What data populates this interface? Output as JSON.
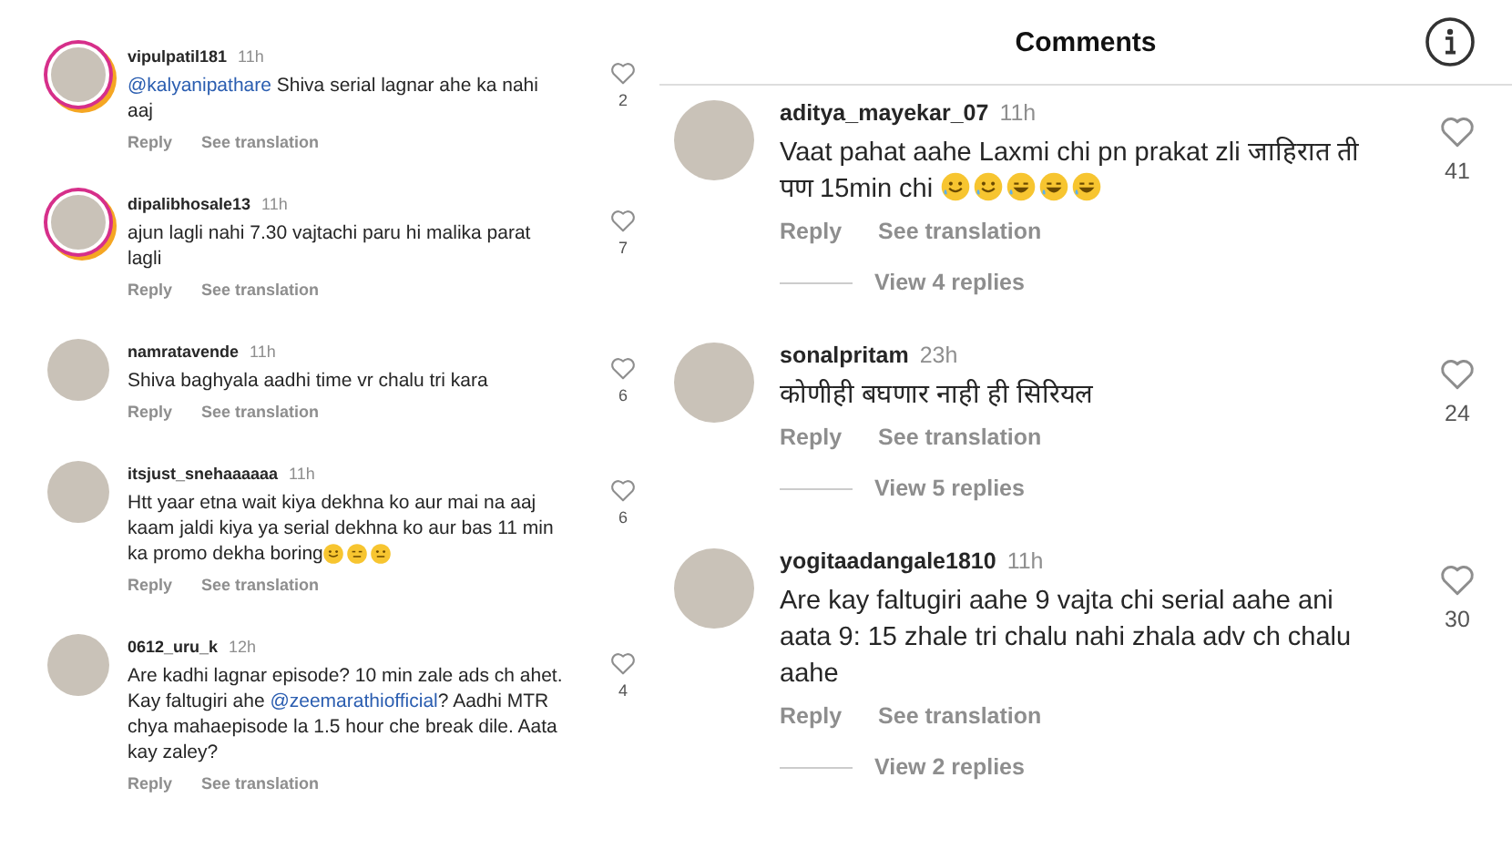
{
  "left_panel": {
    "comments": [
      {
        "username": "vipulpatil181",
        "time": "11h",
        "story": true,
        "parts": [
          {
            "kind": "mention",
            "text": "@kalyanipathare"
          },
          {
            "kind": "plain",
            "text": "  Shiva serial lagnar ahe ka nahi aaj"
          }
        ],
        "actions": [
          "Reply",
          "See translation"
        ],
        "likes": "2"
      },
      {
        "username": "dipalibhosale13",
        "time": "11h",
        "story": true,
        "parts": [
          {
            "kind": "plain",
            "text": "ajun lagli nahi 7.30 vajtachi paru hi malika parat lagli"
          }
        ],
        "actions": [
          "Reply",
          "See translation"
        ],
        "likes": "7"
      },
      {
        "username": "namratavende",
        "time": "11h",
        "story": false,
        "parts": [
          {
            "kind": "plain",
            "text": "Shiva baghyala aadhi time vr chalu tri kara"
          }
        ],
        "actions": [
          "Reply",
          "See translation"
        ],
        "likes": "6"
      },
      {
        "username": "itsjust_snehaaaaaa",
        "time": "11h",
        "story": false,
        "parts": [
          {
            "kind": "plain",
            "text": "Htt yaar etna wait kiya dekhna ko aur mai na aaj kaam jaldi kiya ya serial dekhna ko aur bas 11 min ka promo dekha boring"
          },
          {
            "kind": "smile"
          },
          {
            "kind": "expressionless"
          },
          {
            "kind": "neutral"
          }
        ],
        "actions": [
          "Reply",
          "See translation"
        ],
        "likes": "6"
      },
      {
        "username": "0612_uru_k",
        "time": "12h",
        "story": false,
        "parts": [
          {
            "kind": "plain",
            "text": "Are kadhi lagnar episode? 10 min zale ads ch ahet. Kay faltugiri ahe "
          },
          {
            "kind": "mention",
            "text": "@zeemarathiofficial"
          },
          {
            "kind": "plain",
            "text": "? Aadhi MTR chya mahaepisode la 1.5 hour che break dile. Aata kay zaley?"
          }
        ],
        "actions": [
          "Reply",
          "See translation"
        ],
        "likes": "4"
      }
    ]
  },
  "right_panel": {
    "title": "Comments",
    "comments": [
      {
        "username": "aditya_mayekar_07",
        "time": "11h",
        "story": false,
        "parts": [
          {
            "kind": "plain",
            "text": "Vaat pahat aahe Laxmi chi pn prakat zli जाहिरात ती पण 15min chi "
          },
          {
            "kind": "tearful"
          },
          {
            "kind": "tearful"
          },
          {
            "kind": "laughing"
          },
          {
            "kind": "laughing"
          },
          {
            "kind": "laughing"
          }
        ],
        "actions": [
          "Reply",
          "See translation"
        ],
        "likes": "41",
        "view_replies": "View 4 replies"
      },
      {
        "username": "sonalpritam",
        "time": "23h",
        "story": false,
        "parts": [
          {
            "kind": "plain",
            "text": "कोणीही बघणार नाही ही सिरियल"
          }
        ],
        "actions": [
          "Reply",
          "See translation"
        ],
        "likes": "24",
        "view_replies": "View 5 replies"
      },
      {
        "username": "yogitaadangale1810",
        "time": "11h",
        "story": false,
        "parts": [
          {
            "kind": "plain",
            "text": "Are kay faltugiri aahe 9 vajta chi serial aahe ani aata 9: 15 zhale tri chalu nahi zhala adv ch chalu aahe"
          }
        ],
        "actions": [
          "Reply",
          "See translation"
        ],
        "likes": "30",
        "view_replies": "View 2 replies"
      }
    ]
  }
}
